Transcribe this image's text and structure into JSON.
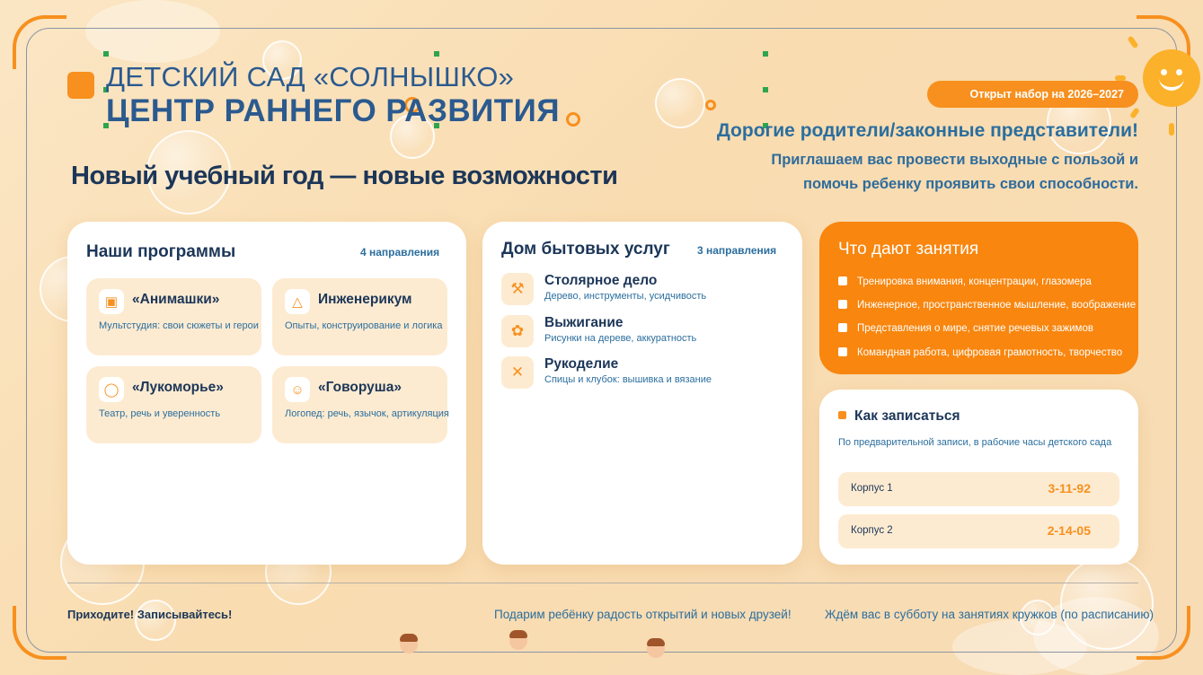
{
  "header": {
    "title_line1": "ДЕТСКИЙ САД «СОЛНЫШКО»",
    "title_line2": "ЦЕНТР РАННЕГО РАЗВИТИЯ",
    "headline": "Новый учебный год — новые возможности",
    "badge": "Открыт набор на 2026–2027"
  },
  "greeting": {
    "title": "Дорогие родители/законные представители!",
    "text": "Приглашаем вас провести выходные с пользой и помочь ребенку проявить свои способности."
  },
  "programs": {
    "title": "Наши программы",
    "count": "4 направления",
    "items": [
      {
        "name": "«Анимашки»",
        "desc": "Мультстудия: свои сюжеты и герои",
        "icon": "film-icon"
      },
      {
        "name": "Инженерикум",
        "desc": "Опыты, конструирование и логика",
        "icon": "flask-icon"
      },
      {
        "name": "«Лукоморье»",
        "desc": "Театр, речь и уверенность",
        "icon": "speech-bubble-icon"
      },
      {
        "name": "«Говоруша»",
        "desc": "Логопед: речь, язычок, артикуляция",
        "icon": "face-icon"
      }
    ]
  },
  "services": {
    "title": "Дом бытовых услуг",
    "count": "3 направления",
    "items": [
      {
        "name": "Столярное дело",
        "desc": "Дерево, инструменты, усидчивость",
        "icon": "hammer-icon"
      },
      {
        "name": "Выжигание",
        "desc": "Рисунки на дереве, аккуратность",
        "icon": "burner-icon"
      },
      {
        "name": "Рукоделие",
        "desc": "Спицы и клубок: вышивка и вязание",
        "icon": "yarn-icon"
      }
    ]
  },
  "benefits": {
    "title": "Что дают занятия",
    "items": [
      "Тренировка внимания, концентрации, глазомера",
      "Инженерное, пространственное мышление, воображение",
      "Представления о мире, снятие речевых зажимов",
      "Командная работа, цифровая грамотность, творчество"
    ]
  },
  "enroll": {
    "title": "Как записаться",
    "subtitle": "По предварительной записи, в рабочие часы детского сада",
    "phones": [
      {
        "label": "Корпус 1",
        "number": "3-11-92"
      },
      {
        "label": "Корпус 2",
        "number": "2-14-05"
      }
    ]
  },
  "footer": {
    "left": "Приходите! Записывайтесь!",
    "middle": "Подарим ребёнку радость открытий и новых друзей!",
    "right": "Ждём вас в субботу на занятиях кружков (по расписанию)"
  },
  "colors": {
    "accent": "#f7901e",
    "primary": "#2b5a8f",
    "background": "#fbe6c4"
  }
}
